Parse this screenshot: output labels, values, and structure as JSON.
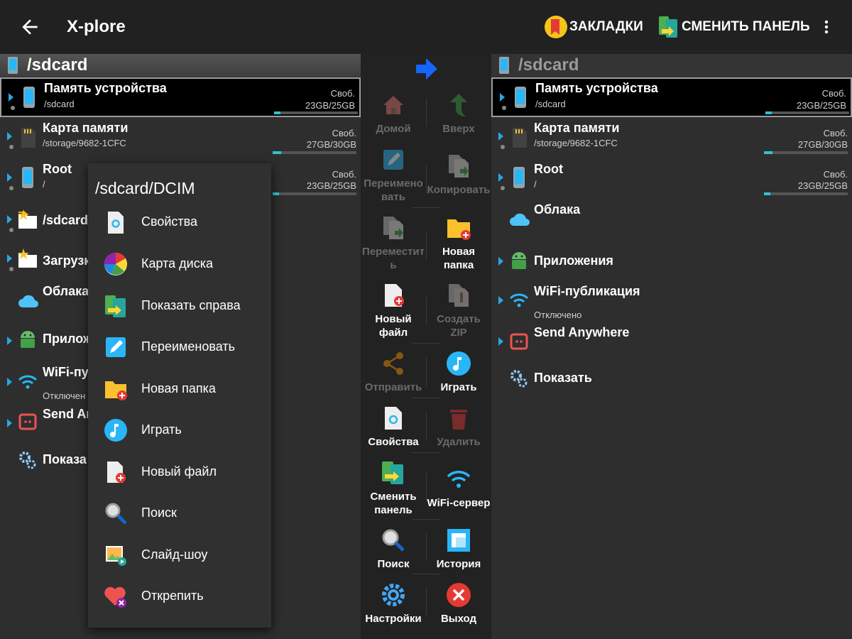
{
  "appbar": {
    "title": "X-plore",
    "bookmarks_label": "ЗАКЛАДКИ",
    "switch_panel_label": "СМЕНИТЬ ПАНЕЛЬ"
  },
  "left_panel": {
    "path": "/sdcard",
    "items": [
      {
        "name": "Память устройства",
        "sub": "/sdcard",
        "free_label": "Своб.",
        "size": "23GB/25GB",
        "fill": 0.08
      },
      {
        "name": "Карта памяти",
        "sub": "/storage/9682-1CFC",
        "free_label": "Своб.",
        "size": "27GB/30GB",
        "fill": 0.1
      },
      {
        "name": "Root",
        "sub": "/",
        "free_label": "Своб.",
        "size": "23GB/25GB",
        "fill": 0.08
      },
      {
        "name": "/sdcard"
      },
      {
        "name": "Загрузк"
      },
      {
        "name": "Облака"
      },
      {
        "name": "Прилож"
      },
      {
        "name": "WiFi-пу",
        "sub": "Отключен"
      },
      {
        "name": "Send An"
      },
      {
        "name": "Показа"
      }
    ]
  },
  "right_panel": {
    "path": "/sdcard",
    "items": [
      {
        "name": "Память устройства",
        "sub": "/sdcard",
        "free_label": "Своб.",
        "size": "23GB/25GB",
        "fill": 0.08
      },
      {
        "name": "Карта памяти",
        "sub": "/storage/9682-1CFC",
        "free_label": "Своб.",
        "size": "27GB/30GB",
        "fill": 0.1
      },
      {
        "name": "Root",
        "sub": "/",
        "free_label": "Своб.",
        "size": "23GB/25GB",
        "fill": 0.08
      },
      {
        "name": "Облака"
      },
      {
        "name": "Приложения"
      },
      {
        "name": "WiFi-публикация",
        "sub": "Отключено"
      },
      {
        "name": "Send Anywhere"
      },
      {
        "name": "Показать"
      }
    ]
  },
  "toolbar": {
    "home": "Домой",
    "up": "Вверх",
    "rename_1": "Переимено",
    "rename_2": "вать",
    "copy": "Копировать",
    "move_1": "Переместит",
    "move_2": "ь",
    "new_folder_1": "Новая",
    "new_folder_2": "папка",
    "new_file_1": "Новый",
    "new_file_2": "файл",
    "create_zip_1": "Создать",
    "create_zip_2": "ZIP",
    "send": "Отправить",
    "play": "Играть",
    "properties": "Свойства",
    "delete": "Удалить",
    "switch_1": "Сменить",
    "switch_2": "панель",
    "wifi_server": "WiFi-сервер",
    "search": "Поиск",
    "history": "История",
    "settings": "Настройки",
    "exit": "Выход"
  },
  "context_menu": {
    "title": "/sdcard/DCIM",
    "items": [
      "Свойства",
      "Карта диска",
      "Показать справа",
      "Переименовать",
      "Новая папка",
      "Играть",
      "Новый файл",
      "Поиск",
      "Слайд-шоу",
      "Открепить"
    ]
  },
  "colors": {
    "accent": "#29a6e6",
    "usage_bar": "#2ec3d6",
    "arrow": "#1565ff"
  }
}
